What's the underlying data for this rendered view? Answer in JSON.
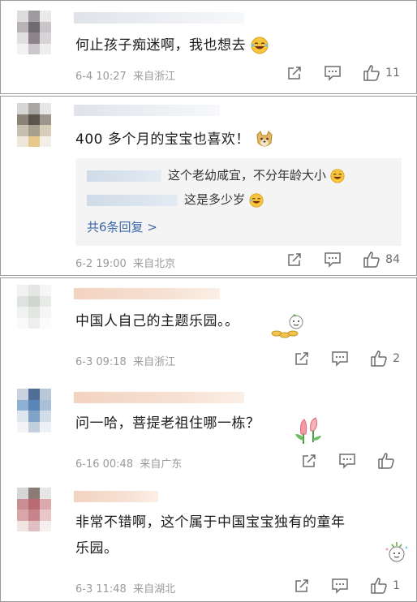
{
  "comments": [
    {
      "text": "何止孩子痴迷啊，我也想去",
      "time": "6-4 10:27",
      "source": "来自浙江",
      "likes": "11",
      "emoji": "laughing-emoji"
    },
    {
      "text": "400 多个月的宝宝也喜欢！",
      "time": "6-2 19:00",
      "source": "来自北京",
      "likes": "84",
      "emoji": "doge-emoji",
      "replies": [
        {
          "text": "这个老幼咸宜，不分年龄大小"
        },
        {
          "text": "这是多少岁"
        }
      ],
      "more_replies": "共6条回复 >"
    },
    {
      "text": "中国人自己的主题乐园。。",
      "time": "6-3 09:18",
      "source": "来自浙江",
      "likes": "2",
      "sticker": "coins-sticker"
    },
    {
      "text": "问一哈，菩提老祖住哪一栋？",
      "time": "6-16 00:48",
      "source": "来自广东",
      "likes": "",
      "sticker": "tulip-sticker"
    },
    {
      "text_line1": "非常不错啊，这个属于中国宝宝独有的童年",
      "text_line2": "乐园。",
      "time": "6-3 11:48",
      "source": "来自湖北",
      "likes": "1",
      "sticker": "celebration-sticker"
    }
  ],
  "icons": {
    "share": "share-icon",
    "comment": "comment-icon",
    "like": "like-icon"
  },
  "colors": {
    "link": "#3b67a8",
    "meta": "#9a9a9a",
    "reply_bg": "#f4f4f4"
  }
}
